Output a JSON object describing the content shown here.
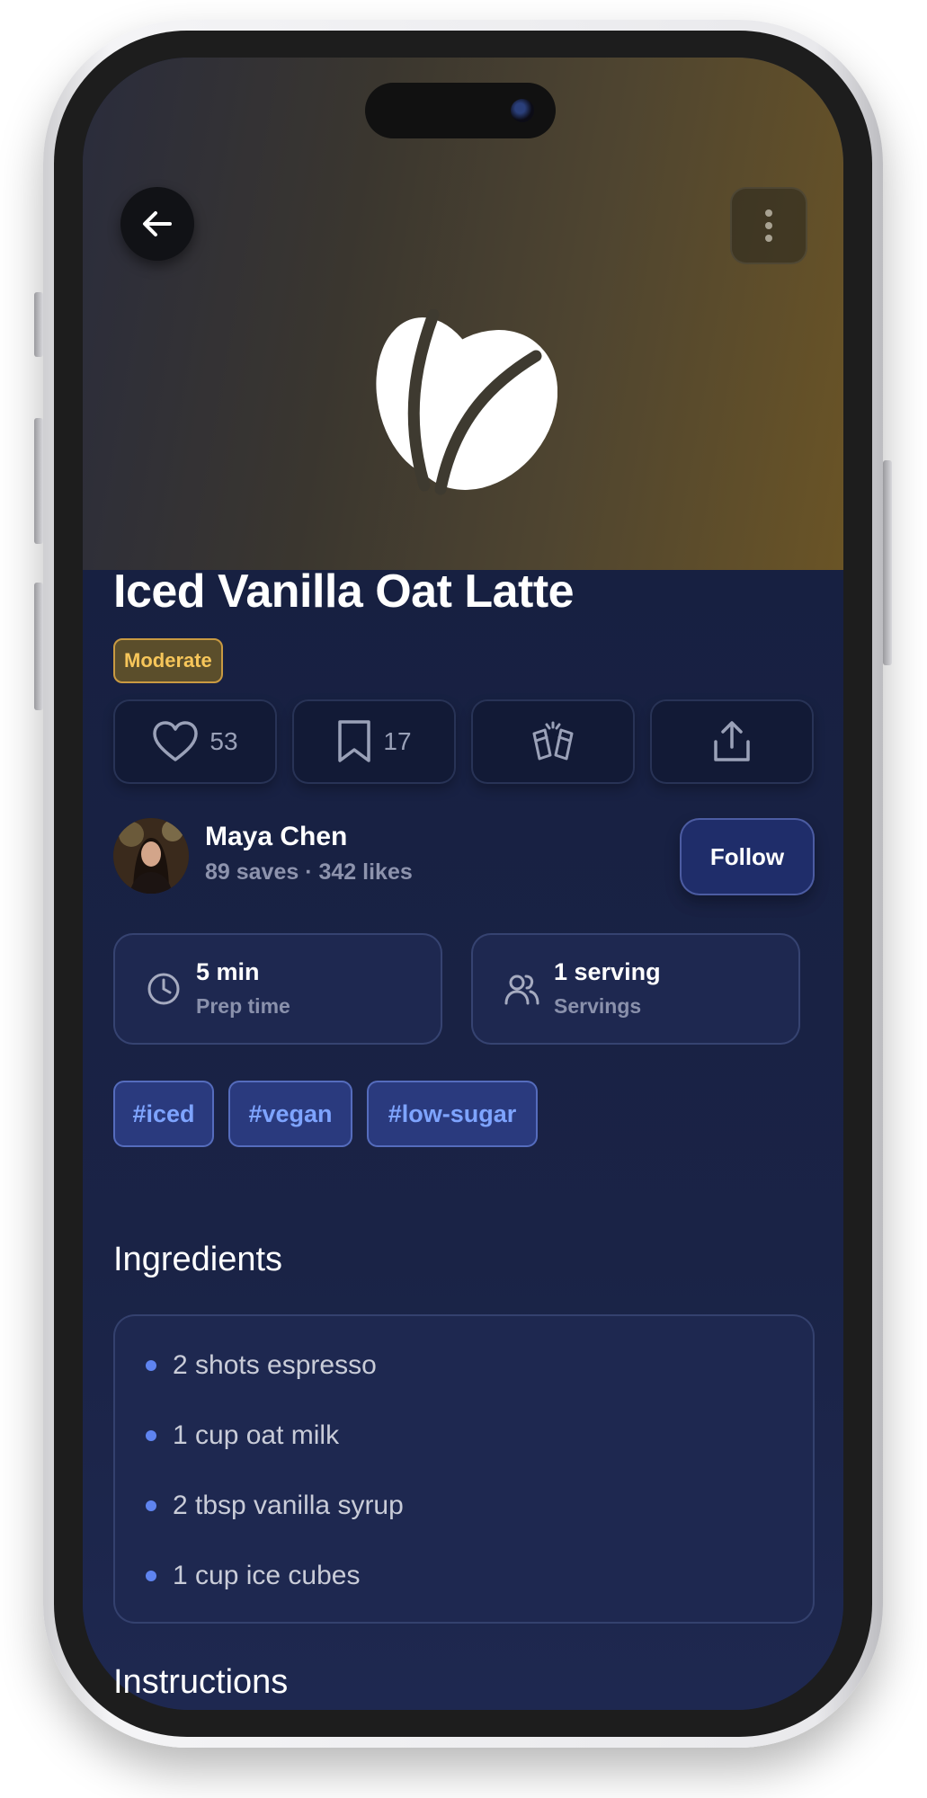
{
  "header": {
    "back_icon": "arrow-left-icon",
    "more_icon": "more-vertical-icon",
    "hero_icon": "coffee-bean-icon",
    "hero_gradient": [
      "#2a2c3c",
      "#6a5426"
    ]
  },
  "recipe": {
    "title": "Iced Vanilla Oat Latte",
    "difficulty": "Moderate"
  },
  "actions": {
    "like_count": "53",
    "save_count": "17",
    "cheers_icon": "cheers-icon",
    "share_icon": "share-icon"
  },
  "author": {
    "name": "Maya Chen",
    "stats": "89 saves · 342 likes",
    "follow_label": "Follow"
  },
  "stats": {
    "prep_value": "5 min",
    "prep_label": "Prep time",
    "servings_value": "1 serving",
    "servings_label": "Servings"
  },
  "tags": [
    "#iced",
    "#vegan",
    "#low-sugar"
  ],
  "ingredients": {
    "heading": "Ingredients",
    "items": [
      "2 shots espresso",
      "1 cup oat milk",
      "2 tbsp vanilla syrup",
      "1 cup ice cubes"
    ]
  },
  "instructions": {
    "heading": "Instructions"
  },
  "colors": {
    "accent": "#5f84f0",
    "badge": "#f7c65a",
    "background": "#1a2346"
  }
}
